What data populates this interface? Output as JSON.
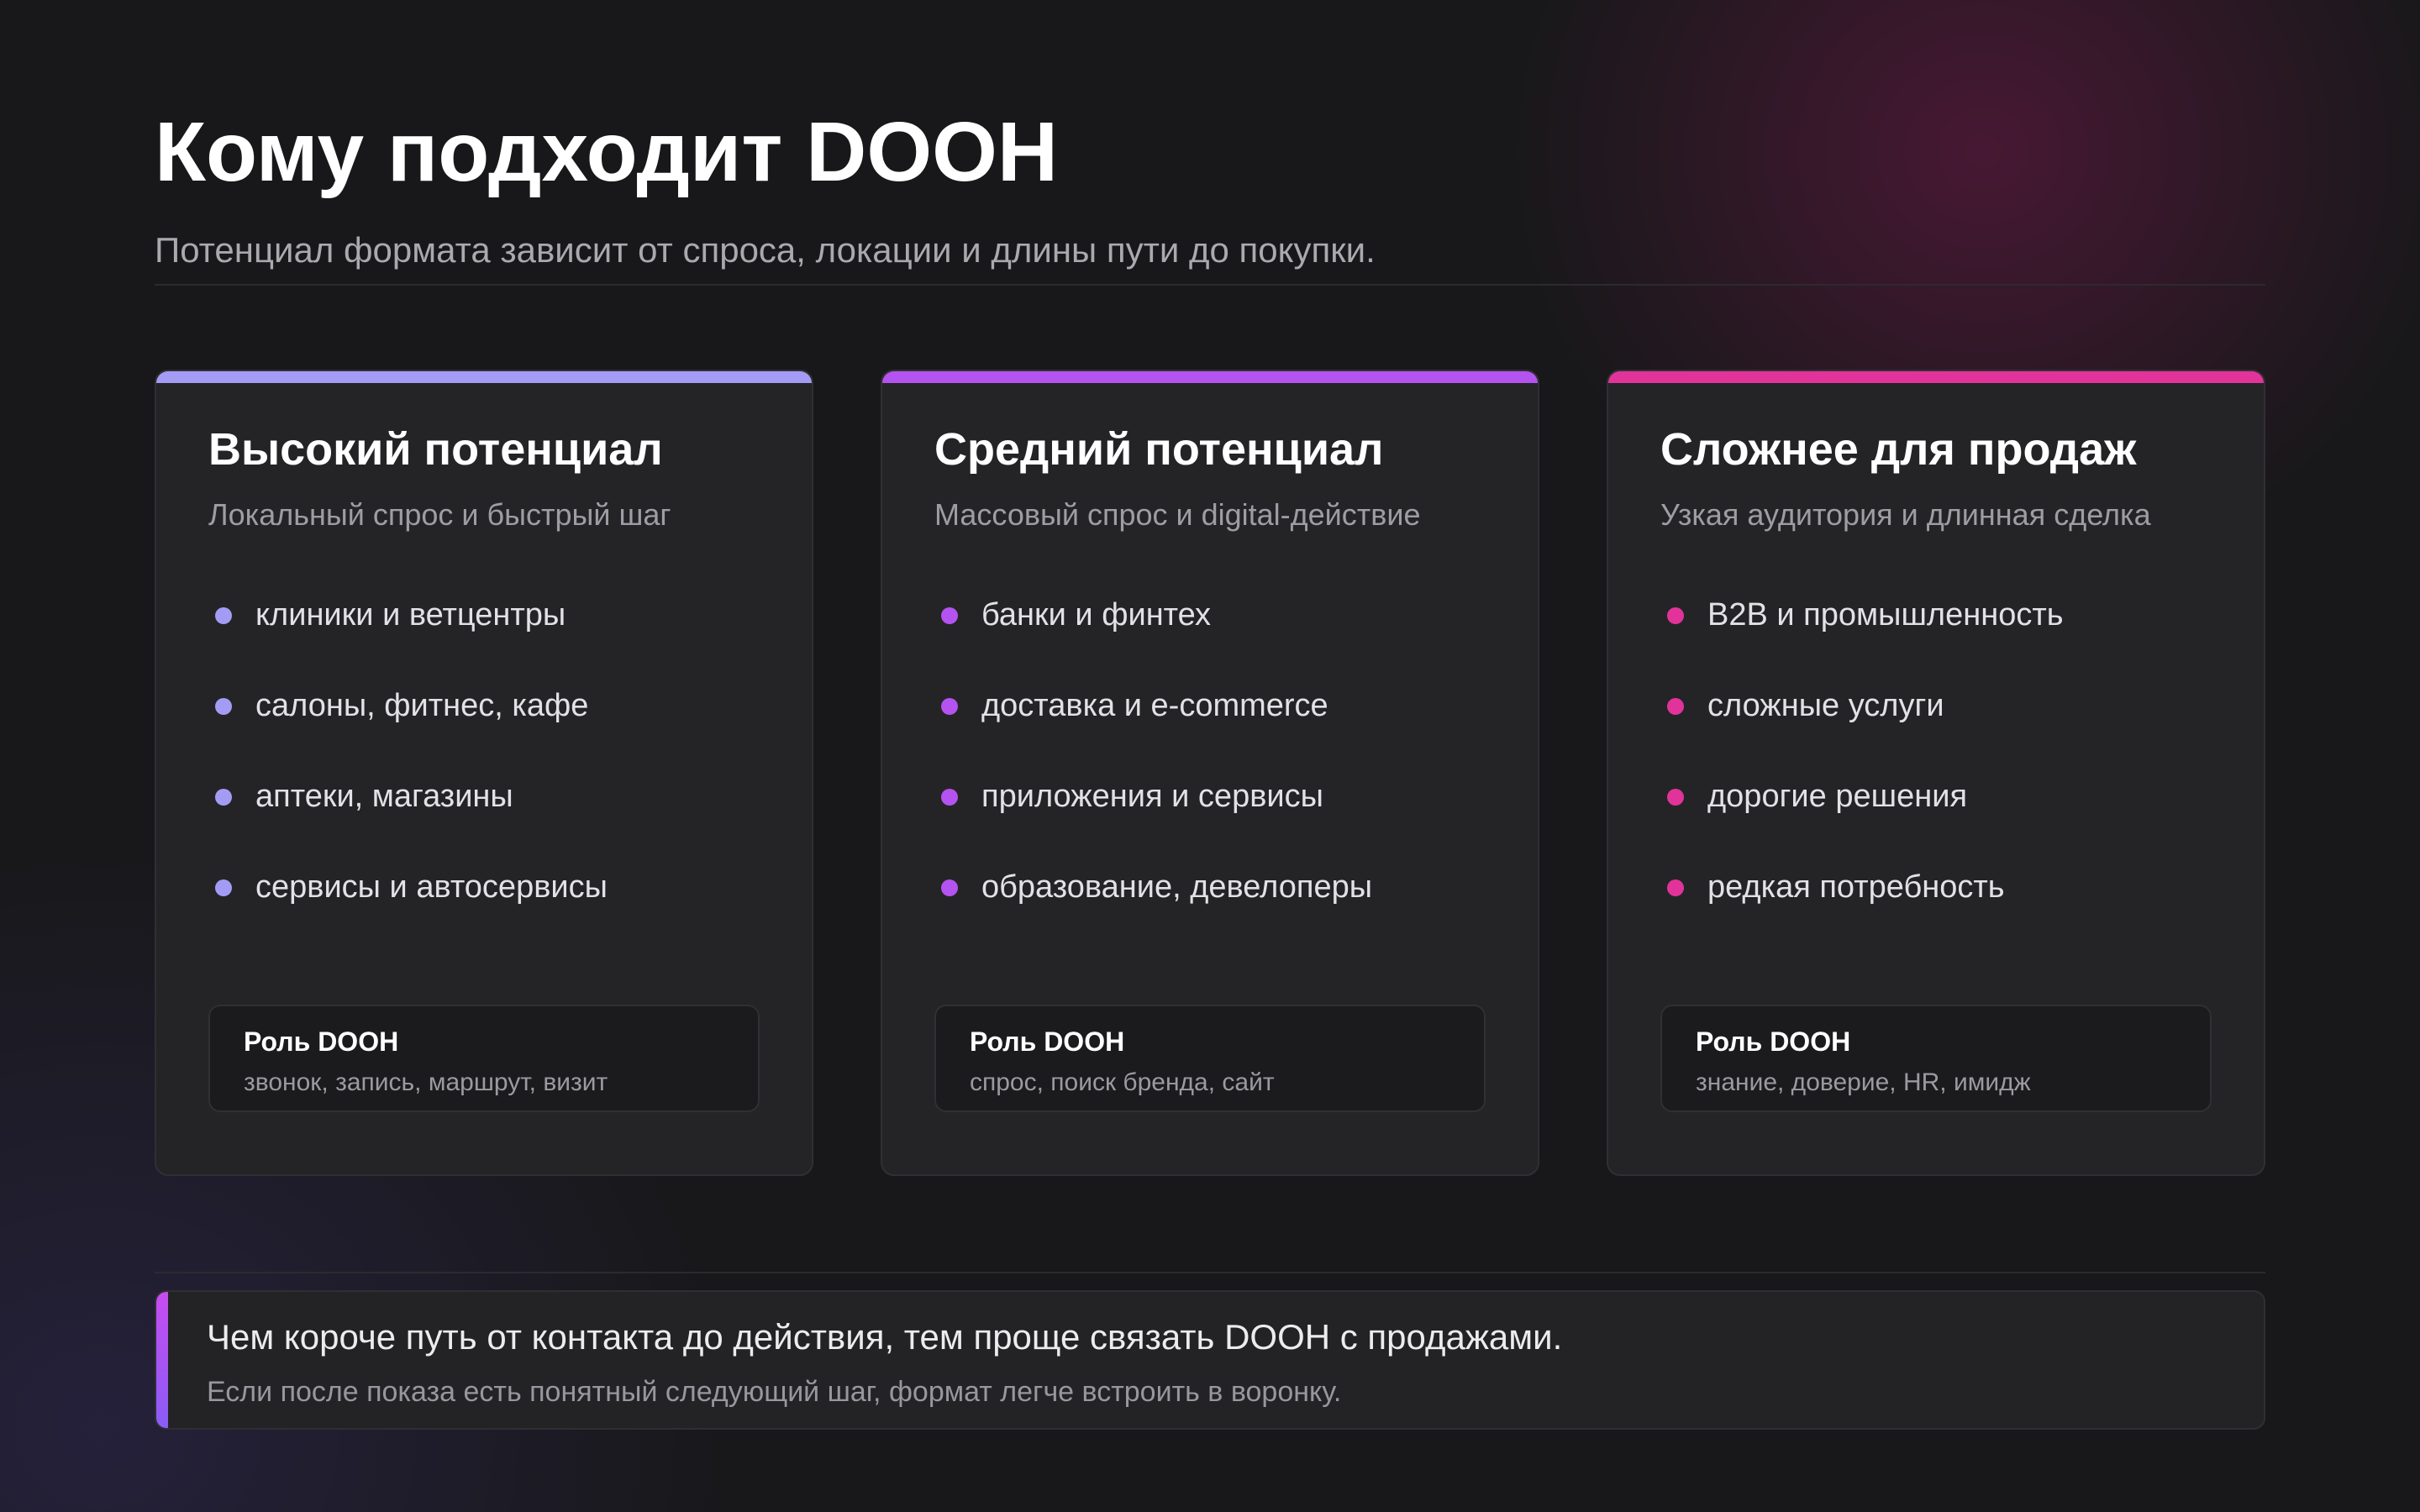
{
  "header": {
    "title": "Кому подходит DOOH",
    "subtitle": "Потенциал формата зависит от спроса, локации и длины пути до покупки."
  },
  "cards": [
    {
      "title": "Высокий потенциал",
      "subtitle": "Локальный спрос и быстрый шаг",
      "accent_color": "#a49cf4",
      "items": [
        "клиники и ветцентры",
        "салоны, фитнес, кафе",
        "аптеки, магазины",
        "сервисы и автосервисы"
      ],
      "role_title": "Роль DOOH",
      "role_text": "звонок, запись, маршрут, визит"
    },
    {
      "title": "Средний потенциал",
      "subtitle": "Массовый спрос и digital-действие",
      "accent_color": "#b453ef",
      "items": [
        "банки и финтех",
        "доставка и e-commerce",
        "приложения и сервисы",
        "образование, девелоперы"
      ],
      "role_title": "Роль DOOH",
      "role_text": "спрос, поиск бренда, сайт"
    },
    {
      "title": "Сложнее для продаж",
      "subtitle": "Узкая аудитория и длинная сделка",
      "accent_color": "#e2339a",
      "items": [
        "B2B и промышленность",
        "сложные услуги",
        "дорогие решения",
        "редкая потребность"
      ],
      "role_title": "Роль DOOH",
      "role_text": "знание, доверие, HR, имидж"
    }
  ],
  "note": {
    "main": "Чем короче путь от контакта до действия, тем проще связать DOOH с продажами.",
    "sub": "Если после показа есть понятный следующий шаг, формат легче встроить в воронку."
  },
  "colors": {
    "background": "#18181a",
    "card_bg": "#242427",
    "note_bar_start": "#c64cf0",
    "note_bar_end": "#8a5cf6"
  }
}
